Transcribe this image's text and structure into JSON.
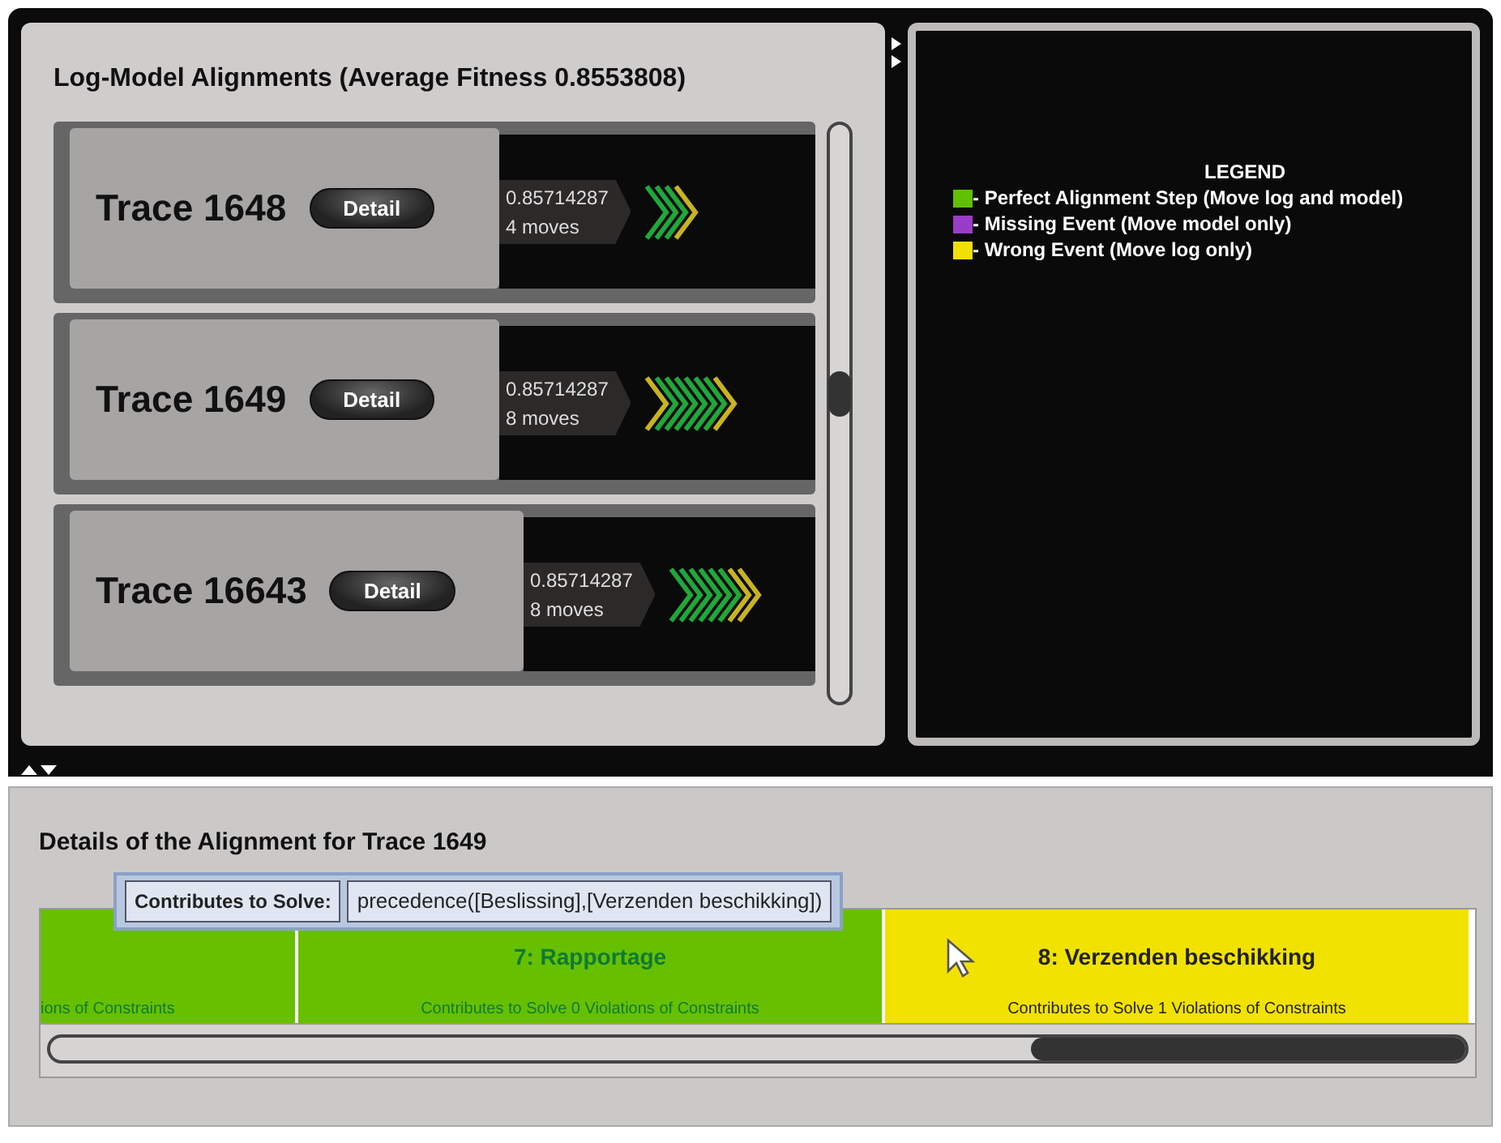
{
  "alignments": {
    "title": "Log-Model Alignments (Average Fitness 0.8553808)",
    "traces": [
      {
        "name": "Trace 1648",
        "button": "Detail",
        "fitness": "0.85714287",
        "moves": "4 moves",
        "steps": [
          {
            "color": "#1fa83a"
          },
          {
            "color": "#1fa83a"
          },
          {
            "color": "#1fa83a"
          },
          {
            "color": "#c8b321"
          }
        ]
      },
      {
        "name": "Trace 1649",
        "button": "Detail",
        "fitness": "0.85714287",
        "moves": "8 moves",
        "steps": [
          {
            "color": "#c8b321"
          },
          {
            "color": "#1fa83a"
          },
          {
            "color": "#1fa83a"
          },
          {
            "color": "#1fa83a"
          },
          {
            "color": "#1fa83a"
          },
          {
            "color": "#1fa83a"
          },
          {
            "color": "#1fa83a"
          },
          {
            "color": "#c8b321"
          }
        ]
      },
      {
        "name": "Trace 16643",
        "button": "Detail",
        "fitness": "0.85714287",
        "moves": "8 moves",
        "steps": [
          {
            "color": "#1fa83a"
          },
          {
            "color": "#1fa83a"
          },
          {
            "color": "#1fa83a"
          },
          {
            "color": "#1fa83a"
          },
          {
            "color": "#1fa83a"
          },
          {
            "color": "#1fa83a"
          },
          {
            "color": "#c8b321"
          },
          {
            "color": "#c8b321"
          }
        ]
      }
    ]
  },
  "legend": {
    "title": "LEGEND",
    "items": [
      {
        "label": "- Perfect Alignment Step (Move log and model)",
        "color": "#5fc100"
      },
      {
        "label": "- Missing Event (Move model only)",
        "color": "#9a3cc8"
      },
      {
        "label": "- Wrong Event (Move log only)",
        "color": "#f2e000"
      }
    ]
  },
  "details": {
    "title": "Details of the Alignment for Trace 1649",
    "tooltip": {
      "label": "Contributes to Solve:",
      "value": "precedence([Beslissing],[Verzenden beschikking])"
    },
    "steps": [
      {
        "subtitle": "ions of Constraints",
        "color": "#66c000",
        "cut": true
      },
      {
        "title": "7: Rapportage",
        "subtitle": "Contributes to Solve 0 Violations of Constraints",
        "color": "#66c000",
        "cut": false
      },
      {
        "title": "8: Verzenden beschikking",
        "subtitle": "Contributes to Solve 1 Violations of Constraints",
        "color": "#f2e200",
        "cut": false
      }
    ]
  }
}
